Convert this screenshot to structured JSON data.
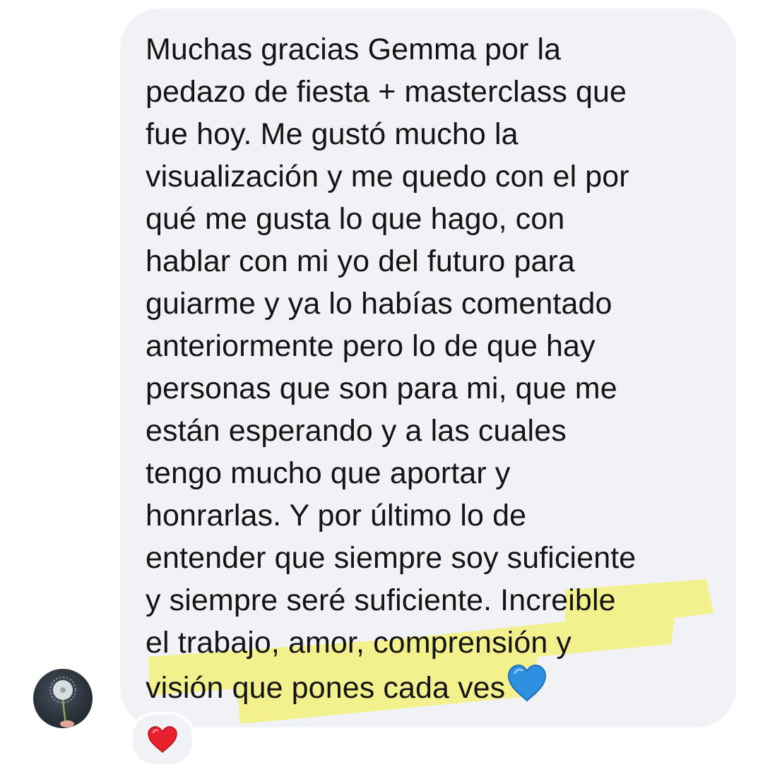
{
  "message": {
    "lines": [
      "Muchas gracias Gemma por la",
      "pedazo de fiesta + masterclass que",
      "fue hoy. Me gustó mucho la",
      "visualización y me quedo con el por",
      "qué me gusta lo que hago, con",
      "hablar con mi yo del futuro para",
      "guiarme y ya lo habías comentado",
      "anteriormente pero lo de que hay",
      "personas que son para mi, que me",
      "están esperando y a las cuales",
      "tengo mucho que aportar y",
      "honrarlas. Y por último lo de",
      "entender que siempre soy suficiente",
      "y siempre seré suficiente. Increible",
      "el trabajo, amor, comprensión y",
      "visión que pones cada ves"
    ],
    "emoji": "blue-heart-icon"
  },
  "reaction": {
    "icon": "red-heart-icon"
  },
  "avatar": {
    "icon": "dandelion-avatar"
  },
  "colors": {
    "bubble": "#f1f2f6",
    "text": "#141414",
    "highlight": "#f2f06a",
    "heart_blue": "#2f8fe0",
    "heart_red": "#e8202e"
  }
}
